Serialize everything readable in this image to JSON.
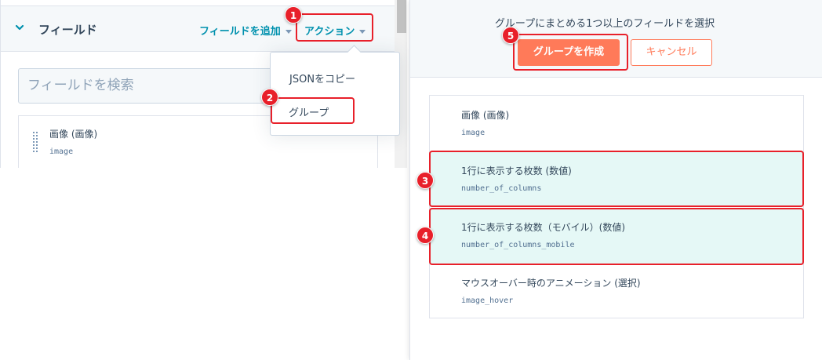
{
  "left_panel": {
    "header_title": "フィールド",
    "add_field_label": "フィールドを追加",
    "actions_label": "アクション",
    "search_placeholder": "フィールドを検索",
    "field": {
      "name": "画像 (画像)",
      "key": "image"
    },
    "dropdown": {
      "items": [
        "JSONをコピー",
        "グループ"
      ]
    }
  },
  "right_panel": {
    "header_title": "グループにまとめる1つ以上のフィールドを選択",
    "create_group_label": "グループを作成",
    "cancel_label": "キャンセル",
    "fields": [
      {
        "name": "画像 (画像)",
        "key": "image",
        "selected": false
      },
      {
        "name": "1行に表示する枚数 (数値)",
        "key": "number_of_columns",
        "selected": true
      },
      {
        "name": "1行に表示する枚数（モバイル）(数値)",
        "key": "number_of_columns_mobile",
        "selected": true
      },
      {
        "name": "マウスオーバー時のアニメーション (選択)",
        "key": "image_hover",
        "selected": false
      }
    ]
  },
  "annotations": {
    "badges": [
      "1",
      "2",
      "3",
      "4",
      "5"
    ]
  },
  "colors": {
    "accent_teal": "#0091ae",
    "primary_orange": "#ff7a59",
    "selected_row_bg": "#e5f8f6",
    "annotation_red": "#e8202a"
  },
  "icons": [
    "chevron-down-icon",
    "caret-down-icon",
    "drag-handle-icon"
  ]
}
